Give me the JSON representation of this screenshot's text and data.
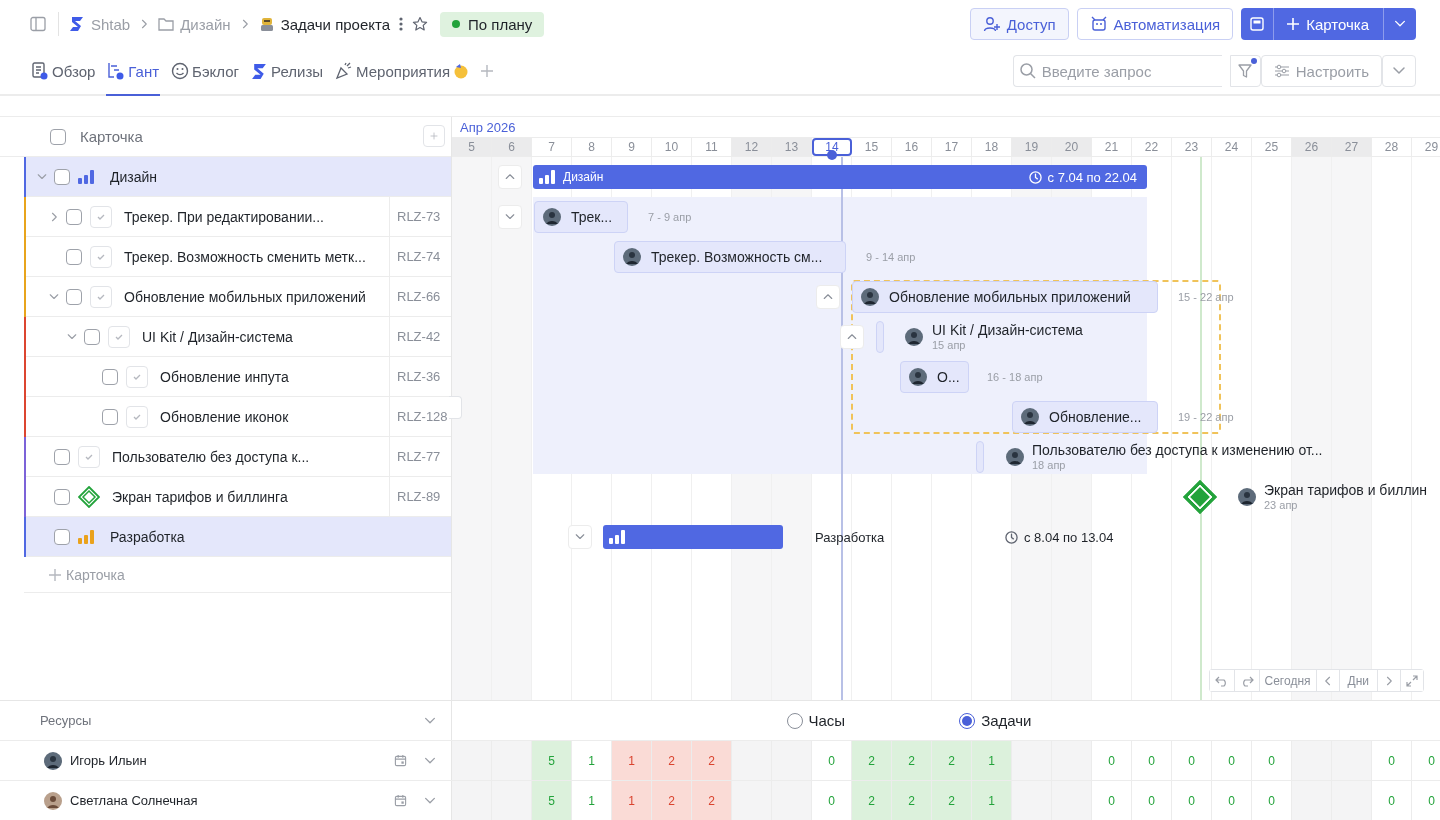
{
  "header": {
    "breadcrumbs": [
      {
        "label": "Shtab",
        "kind": "workspace"
      },
      {
        "label": "Дизайн",
        "kind": "folder"
      },
      {
        "label": "Задачи проекта",
        "kind": "project"
      }
    ],
    "status": {
      "label": "По плану",
      "color": "#23a33b"
    },
    "actions": [
      {
        "label": "Доступ",
        "kind": "access"
      },
      {
        "label": "Автоматизация",
        "kind": "automation"
      }
    ],
    "primary": {
      "label": "Карточка"
    }
  },
  "tabs": [
    {
      "label": "Обзор",
      "kind": "overview",
      "selected": false
    },
    {
      "label": "Гант",
      "kind": "gantt",
      "selected": true
    },
    {
      "label": "Бэклог",
      "kind": "backlog",
      "selected": false
    },
    {
      "label": "Релизы",
      "kind": "releases",
      "selected": false
    },
    {
      "label": "Мероприятия",
      "kind": "events",
      "selected": false
    }
  ],
  "toolbar": {
    "search": {
      "placeholder": "Введите запрос"
    },
    "filter_active": true,
    "configure": "Настроить"
  },
  "list": {
    "header": "Карточка",
    "header_checked": false,
    "add_label": "Карточка",
    "items": [
      {
        "kind": "group",
        "title": "Дизайн",
        "color": "#5068e2",
        "icon": {
          "color": "#5068e2"
        },
        "checked": false,
        "expanded": true,
        "children": [
          {
            "kind": "task",
            "title": "Трекер. При редактировании...",
            "id": "RLZ-73",
            "color": "#e8a41c",
            "checked": false,
            "expanded": false
          },
          {
            "kind": "task",
            "title": "Трекер. Возможность сменить метк...",
            "id": "RLZ-74",
            "color": "#e8a41c",
            "checked": false
          },
          {
            "kind": "task",
            "title": "Обновление мобильных приложений",
            "id": "RLZ-66",
            "color": "#e8a41c",
            "checked": false,
            "expanded": true,
            "children": [
              {
                "kind": "task",
                "title": "UI Kit / Дизайн-система",
                "id": "RLZ-42",
                "color": "#dc4530",
                "checked": false,
                "expanded": true,
                "children": [
                  {
                    "kind": "task",
                    "title": "Обновление инпута",
                    "id": "RLZ-36",
                    "color": "#dc4530",
                    "checked": false
                  },
                  {
                    "kind": "task",
                    "title": "Обновление иконок",
                    "id": "RLZ-128",
                    "color": "#dc4530",
                    "checked": false
                  }
                ]
              }
            ]
          }
        ]
      },
      {
        "kind": "task",
        "title": "Пользователю без доступа к...",
        "id": "RLZ-77",
        "color": "#7c63d8",
        "checked": false
      },
      {
        "kind": "milestone",
        "title": "Экран тарифов и биллинга",
        "id": "RLZ-89",
        "color": "#7c63d8",
        "checked": false
      },
      {
        "kind": "group",
        "title": "Разработка",
        "color": "#5068e2",
        "icon": {
          "color": "#eaa21c"
        },
        "checked": false
      }
    ]
  },
  "timeline": {
    "month": "Апр 2026",
    "days": [
      {
        "label": "5",
        "weekend": true,
        "today": false
      },
      {
        "label": "6",
        "weekend": true,
        "today": false
      },
      {
        "label": "7",
        "weekend": false,
        "today": false
      },
      {
        "label": "8",
        "weekend": false,
        "today": false
      },
      {
        "label": "9",
        "weekend": false,
        "today": false
      },
      {
        "label": "10",
        "weekend": false,
        "today": false
      },
      {
        "label": "11",
        "weekend": false,
        "today": false
      },
      {
        "label": "12",
        "weekend": true,
        "today": false
      },
      {
        "label": "13",
        "weekend": true,
        "today": false
      },
      {
        "label": "14",
        "weekend": false,
        "today": true
      },
      {
        "label": "15",
        "weekend": false,
        "today": false
      },
      {
        "label": "16",
        "weekend": false,
        "today": false
      },
      {
        "label": "17",
        "weekend": false,
        "today": false
      },
      {
        "label": "18",
        "weekend": false,
        "today": false
      },
      {
        "label": "19",
        "weekend": true,
        "today": false
      },
      {
        "label": "20",
        "weekend": true,
        "today": false
      },
      {
        "label": "21",
        "weekend": false,
        "today": false
      },
      {
        "label": "22",
        "weekend": false,
        "today": false
      },
      {
        "label": "23",
        "weekend": false,
        "today": false
      },
      {
        "label": "24",
        "weekend": false,
        "today": false
      },
      {
        "label": "25",
        "weekend": false,
        "today": false
      },
      {
        "label": "26",
        "weekend": true,
        "today": false
      },
      {
        "label": "27",
        "weekend": true,
        "today": false
      },
      {
        "label": "28",
        "weekend": false,
        "today": false
      },
      {
        "label": "29",
        "weekend": false,
        "today": false
      }
    ]
  },
  "gantt": {
    "rows": [
      {
        "kind": "group",
        "title": "Дизайн",
        "dates": "с 7.04 по 22.04",
        "expanded": true
      },
      {
        "kind": "task",
        "title": "Трек...",
        "dates": "7 - 9 апр",
        "expanded": false
      },
      {
        "kind": "task",
        "title": "Трекер. Возможность см...",
        "dates": "9 - 14 апр"
      },
      {
        "kind": "task",
        "title": "Обновление мобильных приложений",
        "dates": "15 - 22 апр",
        "expanded": true
      },
      {
        "kind": "point",
        "title": "UI Kit / Дизайн-система",
        "dates": "15 апр",
        "expanded": true
      },
      {
        "kind": "task",
        "title": "О...",
        "dates": "16 - 18 апр"
      },
      {
        "kind": "task",
        "title": "Обновление...",
        "dates": "19 - 22 апр"
      },
      {
        "kind": "point",
        "title": "Пользователю без доступа к изменению от...",
        "dates": "18 апр"
      },
      {
        "kind": "milestone",
        "title": "Экран тарифов и биллин",
        "dates": "23 апр"
      },
      {
        "kind": "group",
        "title": "Разработка",
        "dates": "с 8.04 по 13.04",
        "expanded": false
      }
    ]
  },
  "controls": {
    "today": "Сегодня",
    "scale": "Дни"
  },
  "resources": {
    "title": "Ресурсы",
    "modes": [
      {
        "label": "Часы",
        "selected": false
      },
      {
        "label": "Задачи",
        "selected": true
      }
    ],
    "people": [
      {
        "name": "Игорь Ильин",
        "cells": [
          {
            "busy": false,
            "over": false
          },
          {
            "busy": false,
            "over": false
          },
          {
            "value": "5",
            "busy": true,
            "over": false
          },
          {
            "value": "1",
            "busy": false,
            "over": false
          },
          {
            "value": "1",
            "over": true
          },
          {
            "value": "2",
            "over": true
          },
          {
            "value": "2",
            "over": true
          },
          {
            "busy": false,
            "over": false
          },
          {
            "busy": false,
            "over": false
          },
          {
            "value": "0",
            "busy": false,
            "over": false
          },
          {
            "value": "2",
            "busy": true,
            "over": false
          },
          {
            "value": "2",
            "busy": true,
            "over": false
          },
          {
            "value": "2",
            "busy": true,
            "over": false
          },
          {
            "value": "1",
            "busy": true,
            "over": false
          },
          {
            "busy": false,
            "over": false
          },
          {
            "busy": false,
            "over": false
          },
          {
            "value": "0",
            "busy": false,
            "over": false
          },
          {
            "value": "0",
            "busy": false,
            "over": false
          },
          {
            "value": "0",
            "busy": false,
            "over": false
          },
          {
            "value": "0",
            "busy": false,
            "over": false
          },
          {
            "value": "0",
            "busy": false,
            "over": false
          },
          {
            "busy": false,
            "over": false
          },
          {
            "busy": false,
            "over": false
          },
          {
            "value": "0",
            "busy": false,
            "over": false
          },
          {
            "value": "0",
            "busy": false,
            "over": false
          }
        ]
      },
      {
        "name": "Светлана Солнечная",
        "cells": [
          {
            "busy": false,
            "over": false
          },
          {
            "busy": false,
            "over": false
          },
          {
            "value": "5",
            "busy": true,
            "over": false
          },
          {
            "value": "1",
            "busy": false,
            "over": false
          },
          {
            "value": "1",
            "over": true
          },
          {
            "value": "2",
            "over": true
          },
          {
            "value": "2",
            "over": true
          },
          {
            "busy": false,
            "over": false
          },
          {
            "busy": false,
            "over": false
          },
          {
            "value": "0",
            "busy": false,
            "over": false
          },
          {
            "value": "2",
            "busy": true,
            "over": false
          },
          {
            "value": "2",
            "busy": true,
            "over": false
          },
          {
            "value": "2",
            "busy": true,
            "over": false
          },
          {
            "value": "1",
            "busy": true,
            "over": false
          },
          {
            "busy": false,
            "over": false
          },
          {
            "busy": false,
            "over": false
          },
          {
            "value": "0",
            "busy": false,
            "over": false
          },
          {
            "value": "0",
            "busy": false,
            "over": false
          },
          {
            "value": "0",
            "busy": false,
            "over": false
          },
          {
            "value": "0",
            "busy": false,
            "over": false
          },
          {
            "value": "0",
            "busy": false,
            "over": false
          },
          {
            "busy": false,
            "over": false
          },
          {
            "busy": false,
            "over": false
          },
          {
            "value": "0",
            "busy": false,
            "over": false
          },
          {
            "value": "0",
            "busy": false,
            "over": false
          }
        ]
      }
    ]
  }
}
